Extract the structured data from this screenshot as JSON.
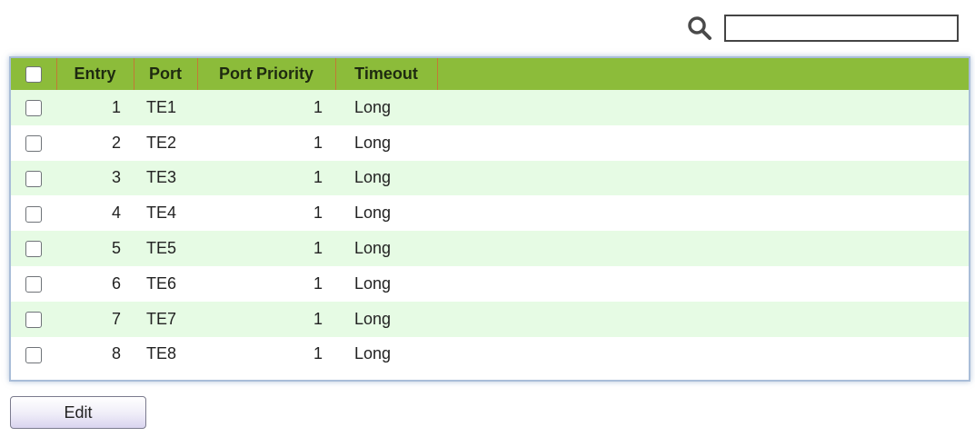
{
  "search": {
    "icon": "search-icon",
    "value": "",
    "placeholder": ""
  },
  "table": {
    "columns": {
      "entry": "Entry",
      "port": "Port",
      "port_priority": "Port Priority",
      "timeout": "Timeout"
    },
    "rows": [
      {
        "entry": "1",
        "port": "TE1",
        "priority": "1",
        "timeout": "Long",
        "checked": false
      },
      {
        "entry": "2",
        "port": "TE2",
        "priority": "1",
        "timeout": "Long",
        "checked": false
      },
      {
        "entry": "3",
        "port": "TE3",
        "priority": "1",
        "timeout": "Long",
        "checked": false
      },
      {
        "entry": "4",
        "port": "TE4",
        "priority": "1",
        "timeout": "Long",
        "checked": false
      },
      {
        "entry": "5",
        "port": "TE5",
        "priority": "1",
        "timeout": "Long",
        "checked": false
      },
      {
        "entry": "6",
        "port": "TE6",
        "priority": "1",
        "timeout": "Long",
        "checked": false
      },
      {
        "entry": "7",
        "port": "TE7",
        "priority": "1",
        "timeout": "Long",
        "checked": false
      },
      {
        "entry": "8",
        "port": "TE8",
        "priority": "1",
        "timeout": "Long",
        "checked": false
      }
    ]
  },
  "actions": {
    "edit_label": "Edit"
  },
  "colors": {
    "header_bg": "#8cbc3a",
    "row_odd_bg": "#e6fbe4",
    "row_even_bg": "#ffffff",
    "frame_border": "#a9bdd8",
    "header_divider": "#c27a36"
  }
}
